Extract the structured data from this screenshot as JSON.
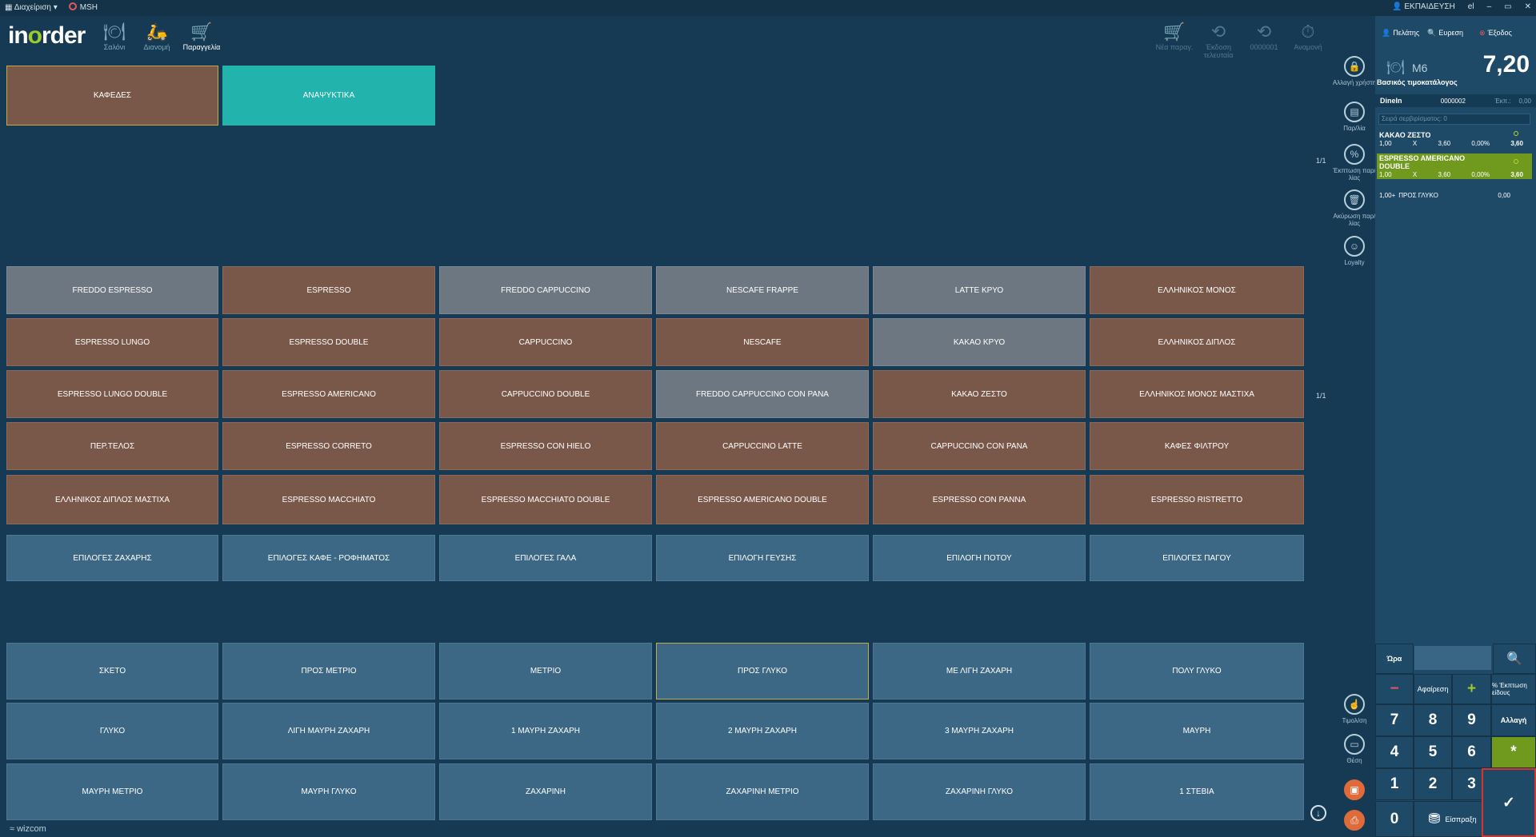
{
  "topbar": {
    "menu": "Διαχείριση",
    "record": "MSH",
    "user": "ΕΚΠΑΙΔΕΥΣΗ",
    "lang": "el"
  },
  "logo": {
    "pre": "in",
    "accent": "o",
    "post": "rder"
  },
  "toolbar": {
    "left": [
      {
        "label": "Σαλόνι"
      },
      {
        "label": "Διανομή"
      },
      {
        "label": "Παραγγελία"
      }
    ],
    "right": [
      {
        "label": "Νέα παραγ."
      },
      {
        "label": "Έκδοση τελευταία"
      },
      {
        "label": "0000001"
      },
      {
        "label": "Αναμονή"
      }
    ]
  },
  "categories": [
    "ΚΑΦΕΔΕΣ",
    "ΑΝΑΨΥΚΤΙΚΑ"
  ],
  "pager1": "1/1",
  "pager2": "1/1",
  "products": [
    "FREDDO ESPRESSO",
    "ESPRESSO",
    "FREDDO CAPPUCCINO",
    "NESCAFE FRAPPE",
    "LATTE ΚΡΥΟ",
    "ΕΛΛΗΝΙΚΟΣ ΜΟΝΟΣ",
    "ESPRESSO LUNGO",
    "ESPRESSO DOUBLE",
    "CAPPUCCINO",
    "NESCAFE",
    "ΚΑΚΑΟ ΚΡΥΟ",
    "ΕΛΛΗΝΙΚΟΣ ΔΙΠΛΟΣ",
    "ESPRESSO LUNGO DOUBLE",
    "ESPRESSO AMERICANO",
    "CAPPUCCINO DOUBLE",
    "FREDDO CAPPUCCINO CON PANA",
    "ΚΑΚΑΟ ΖΕΣΤΟ",
    "ΕΛΛΗΝΙΚΟΣ ΜΟΝΟΣ ΜΑΣΤΙΧΑ",
    "ΠΕΡ.ΤΕΛΟΣ",
    "ESPRESSO CORRETO",
    "ESPRESSO CON HIELO",
    "CAPPUCCINO LATTE",
    "CAPPUCCINO CON PANA",
    "ΚΑΦΕΣ ΦΙΛΤΡΟΥ",
    "ΕΛΛΗΝΙΚΟΣ ΔΙΠΛΟΣ ΜΑΣΤΙΧΑ",
    "ESPRESSO MACCHIATO",
    "ESPRESSO MACCHIATO DOUBLE",
    "ESPRESSO AMERICANO DOUBLE",
    "ESPRESSO CON PANNA",
    "ESPRESSO RISTRETTO"
  ],
  "option_groups": [
    "ΕΠΙΛΟΓΕΣ ΖΑΧΑΡΗΣ",
    "ΕΠΙΛΟΓΕΣ ΚΑΦΕ - ΡΟΦΗΜΑΤΟΣ",
    "ΕΠΙΛΟΓΕΣ ΓΑΛΑ",
    "ΕΠΙΛΟΓΗ ΓΕΥΣΗΣ",
    "ΕΠΙΛΟΓΗ ΠΟΤΟΥ",
    "ΕΠΙΛΟΓΕΣ ΠΑΓΟΥ"
  ],
  "options": [
    "ΣΚΕΤΟ",
    "ΠΡΟΣ ΜΕΤΡΙΟ",
    "ΜΕΤΡΙΟ",
    "ΠΡΟΣ ΓΛΥΚΟ",
    "ΜΕ ΛΙΓΗ ΖΑΧΑΡΗ",
    "ΠΟΛΥ ΓΛΥΚΟ",
    "ΓΛΥΚΟ",
    "ΛΙΓΗ ΜΑΥΡΗ ΖΑΧΑΡΗ",
    "1 ΜΑΥΡΗ ΖΑΧΑΡΗ",
    "2 ΜΑΥΡΗ ΖΑΧΑΡΗ",
    "3 ΜΑΥΡΗ ΖΑΧΑΡΗ",
    "ΜΑΥΡΗ",
    "ΜΑΥΡΗ ΜΕΤΡΙΟ",
    "ΜΑΥΡΗ ΓΛΥΚΟ",
    "ΖΑΧΑΡΙΝΗ",
    "ΖΑΧΑΡΙΝΗ ΜΕΤΡΙΟ",
    "ΖΑΧΑΡΙΝΗ ΓΛΥΚΟ",
    "1 ΣΤΕΒΙΑ"
  ],
  "side_tools": [
    {
      "label": "Αλλαγή χρήστη",
      "icon": "lock-icon"
    },
    {
      "label": "Παρ/λία",
      "icon": "receipt-icon"
    },
    {
      "label": "Έκπτωση παρ/λίας",
      "icon": "percent-icon"
    },
    {
      "label": "Ακύρωση παρ/λίας",
      "icon": "trash-icon"
    },
    {
      "label": "Loyalty",
      "icon": "loyalty-icon"
    },
    {
      "label": "Τιμολ/ση",
      "icon": "invoice-icon"
    },
    {
      "label": "Θέση",
      "icon": "seat-icon"
    }
  ],
  "right_panel": {
    "top": {
      "customer": "Πελάτης",
      "search": "Ευρεση",
      "exit": "Έξοδος"
    },
    "table": "M6",
    "total": "7,20",
    "pricelist": "Βασικός τιμοκατάλογος",
    "dine": {
      "type": "DineIn",
      "number": "0000002",
      "disc_label": "Έκπ.:",
      "disc": "0,00"
    },
    "serving_order": "Σειρά σερβιρίσματος: 0",
    "lines": [
      {
        "name": "ΚΑΚΑΟ ΖΕΣΤΟ",
        "qty": "1,00",
        "x": "X",
        "price": "3,60",
        "pct": "0,00%",
        "amount": "3,60"
      },
      {
        "name": "ESPRESSO AMERICANO DOUBLE",
        "qty": "1,00",
        "x": "X",
        "price": "3,60",
        "pct": "0,00%",
        "amount": "3,60"
      }
    ],
    "modifier": {
      "qty": "1,00",
      "plus": "+",
      "name": "ΠΡΟΣ ΓΛΥΚΟ",
      "amount": "0,00"
    }
  },
  "keypad": {
    "time_label": "Ώρα",
    "subtract_label": "Αφαίρεση",
    "item_discount": "% Έκπτωση είδους",
    "change": "Αλλαγή",
    "collect": "Είσπραξη",
    "star": "*",
    "minus": "−",
    "plus": "+",
    "check": "✓",
    "digits": [
      "7",
      "8",
      "9",
      "4",
      "5",
      "6",
      "1",
      "2",
      "3",
      "0"
    ]
  },
  "footer": {
    "brand": "wizcom"
  }
}
